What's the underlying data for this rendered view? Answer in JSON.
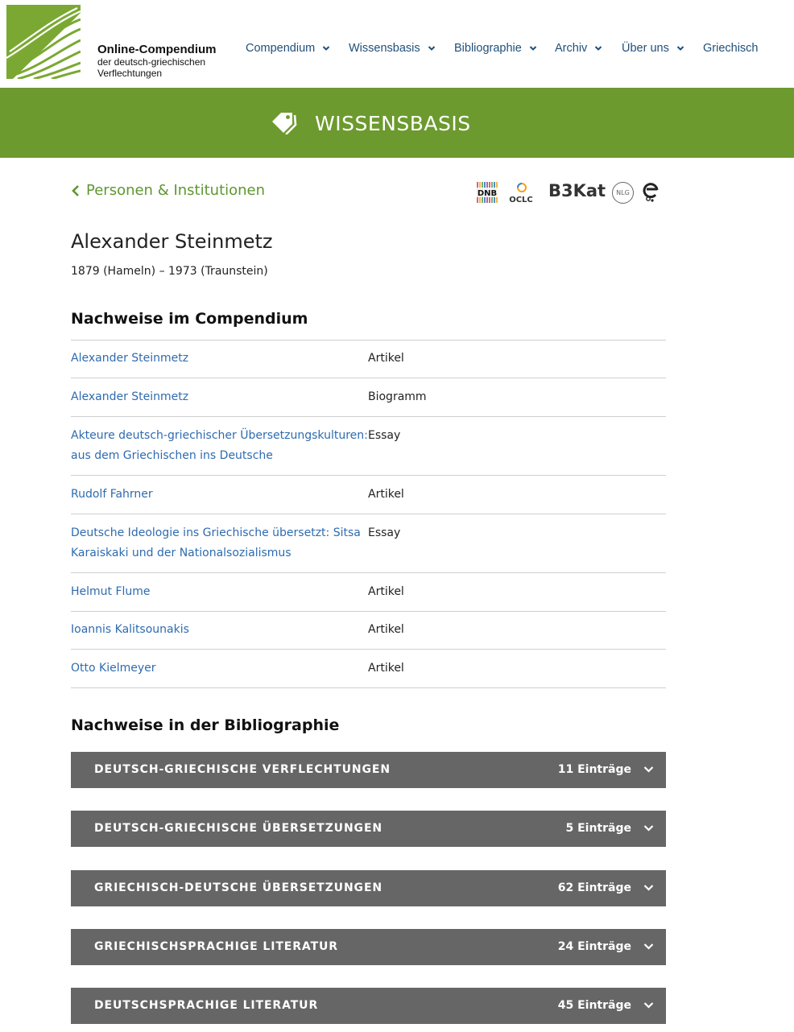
{
  "logo": {
    "title": "Online-Compendium",
    "sub_line1": "der deutsch-griechischen",
    "sub_line2": "Verflechtungen"
  },
  "nav": {
    "items": [
      {
        "label": "Compendium",
        "has_dropdown": true
      },
      {
        "label": "Wissensbasis",
        "has_dropdown": true
      },
      {
        "label": "Bibliographie",
        "has_dropdown": true
      },
      {
        "label": "Archiv",
        "has_dropdown": true
      },
      {
        "label": "Über uns",
        "has_dropdown": true
      },
      {
        "label": "Griechisch",
        "has_dropdown": false
      }
    ]
  },
  "banner": {
    "title": "WISSENSBASIS",
    "icon": "tag-icon"
  },
  "back_link": {
    "label": "Personen & Institutionen"
  },
  "catalogues": {
    "dnb": "DNB",
    "oclc": "OCLC",
    "b3kat": "B3Kat",
    "nlg": "NLG"
  },
  "person": {
    "name": "Alexander Steinmetz",
    "dates": "1879 (Hameln) – 1973 (Traunstein)"
  },
  "compendium": {
    "heading": "Nachweise im Compendium",
    "rows": [
      {
        "title": "Alexander Steinmetz",
        "type": "Artikel"
      },
      {
        "title": "Alexander Steinmetz",
        "type": "Biogramm"
      },
      {
        "title": "Akteure deutsch-griechischer Übersetzungskulturen: aus dem Griechischen ins Deutsche",
        "type": "Essay"
      },
      {
        "title": "Rudolf Fahrner",
        "type": "Artikel"
      },
      {
        "title": "Deutsche Ideologie ins Griechische übersetzt: Sitsa Karaiskaki und der Nationalsozialismus",
        "type": "Essay"
      },
      {
        "title": "Helmut Flume",
        "type": "Artikel"
      },
      {
        "title": "Ioannis Kalitsounakis",
        "type": "Artikel"
      },
      {
        "title": "Otto Kielmeyer",
        "type": "Artikel"
      }
    ]
  },
  "bibliography": {
    "heading": "Nachweise in der Bibliographie",
    "sections": [
      {
        "title": "DEUTSCH-GRIECHISCHE VERFLECHTUNGEN",
        "count": "11 Einträge"
      },
      {
        "title": "DEUTSCH-GRIECHISCHE ÜBERSETZUNGEN",
        "count": "5 Einträge"
      },
      {
        "title": "GRIECHISCH-DEUTSCHE ÜBERSETZUNGEN",
        "count": "62 Einträge"
      },
      {
        "title": "GRIECHISCHSPRACHIGE LITERATUR",
        "count": "24 Einträge"
      },
      {
        "title": "DEUTSCHSPRACHIGE LITERATUR",
        "count": "45 Einträge"
      }
    ]
  },
  "colors": {
    "brand_green": "#6c9a2e",
    "link_blue": "#2e6bb0",
    "nav_blue": "#1f4f7a",
    "accordion_gray": "#666666"
  }
}
